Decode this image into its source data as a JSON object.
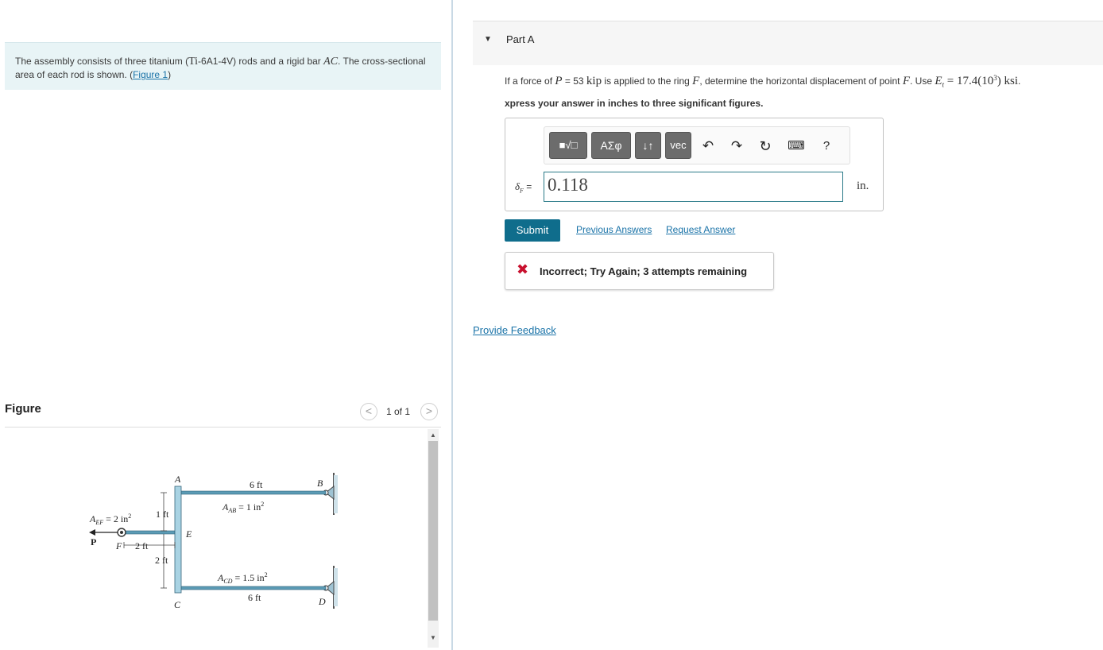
{
  "intro": {
    "text_before": "The assembly consists of three titanium (",
    "material_chem": "Ti",
    "material_rest": "-6A1-4V) rods and a rigid bar ",
    "bar": "AC",
    "text_after": ". The cross-sectional area of each rod is shown. (",
    "figure_link": "Figure 1",
    "close_paren": ")"
  },
  "figure": {
    "title": "Figure",
    "counter": "1 of 1",
    "prev_glyph": "<",
    "next_glyph": ">",
    "labels": {
      "A": "A",
      "B": "B",
      "C": "C",
      "D": "D",
      "E": "E",
      "F": "F",
      "P": "P",
      "top_length": "6 ft",
      "bottom_length": "6 ft",
      "a_ab": "A",
      "a_ab_sub": "AB",
      "a_ab_val": " = 1 in",
      "a_cd": "A",
      "a_cd_sub": "CD",
      "a_cd_val": " = 1.5 in",
      "a_ef": "A",
      "a_ef_sub": "EF",
      "a_ef_val": " = 2 in",
      "sq": "2",
      "dim_1ft": "1 ft",
      "dim_2ft_h": "2 ft",
      "dim_2ft_v": "2 ft"
    }
  },
  "part": {
    "title": "Part A",
    "caret": "▼"
  },
  "question": {
    "t1": "If a force of ",
    "P": "P",
    "t2": " = 53 ",
    "kip": "kip",
    "t3": " is applied to the ring ",
    "F": "F",
    "t4": ", determine the horizontal displacement of point ",
    "F2": "F",
    "t5": ". Use ",
    "E": "E",
    "Esub": "t",
    "t6": " = 17.4(10",
    "exp": "3",
    "t7": ") ",
    "ksi": "ksi",
    "t8": "."
  },
  "instruction": "xpress your answer in inches to three significant figures.",
  "toolbar": {
    "templates_icon": "■√□",
    "greek_label": "ΑΣφ",
    "arrows_label": "↓↑",
    "vec_label": "vec",
    "undo_icon": "undo-icon",
    "redo_icon": "redo-icon",
    "reset_icon": "reset-icon",
    "keyboard_icon": "keyboard-icon",
    "help_label": "?"
  },
  "answer": {
    "label": "δ",
    "label_sub": "F",
    "label_eq": " =",
    "value": "0.118",
    "unit": "in."
  },
  "actions": {
    "submit": "Submit",
    "previous_answers": "Previous Answers",
    "request_answer": "Request Answer"
  },
  "feedback": {
    "icon": "✖",
    "message": "Incorrect; Try Again; 3 attempts remaining"
  },
  "provide_feedback": "Provide Feedback",
  "colors": {
    "accent": "#0f6d8c",
    "link": "#1a73a8",
    "error": "#c8102e",
    "intro_bg": "#e8f4f6",
    "rod": "#5b9bb5"
  }
}
